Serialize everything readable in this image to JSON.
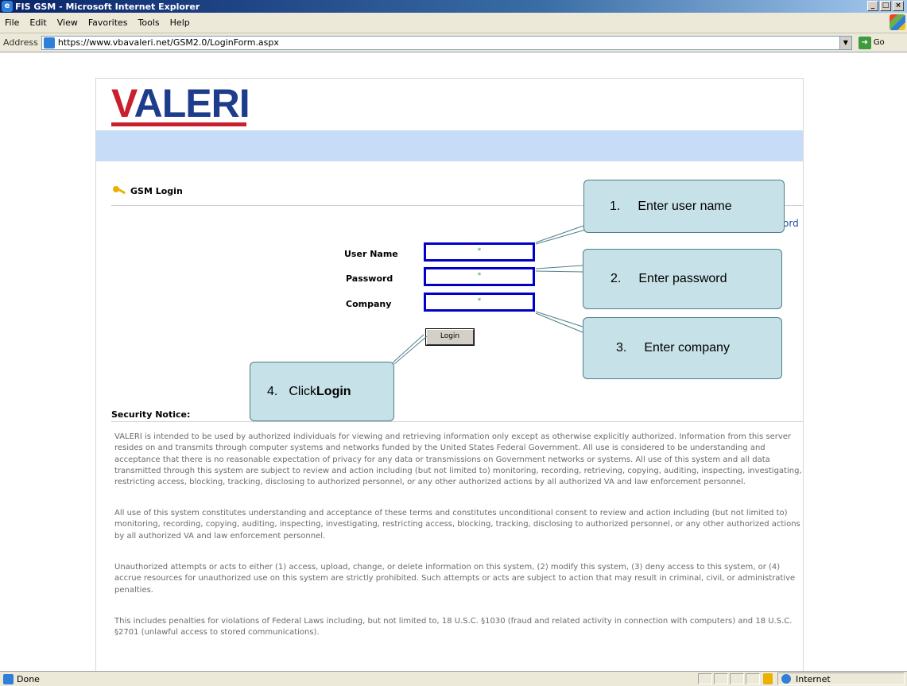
{
  "window": {
    "title": "FIS GSM - Microsoft Internet Explorer",
    "controls": [
      "_",
      "□",
      "×"
    ]
  },
  "menu": [
    "File",
    "Edit",
    "View",
    "Favorites",
    "Tools",
    "Help"
  ],
  "address": {
    "label": "Address",
    "url": "https://www.vbavaleri.net/GSM2.0/LoginForm.aspx",
    "go_label": "Go"
  },
  "page": {
    "logo_text": "VALERI",
    "section_title": "GSM Login",
    "cut_link_text": "ord",
    "form": {
      "username_label": "User Name",
      "password_label": "Password",
      "company_label": "Company",
      "field_marker": "*",
      "login_button": "Login"
    },
    "security_title": "Security Notice:",
    "notice_paragraphs": [
      "VALERI is intended to be used by authorized individuals for viewing and retrieving information only except as otherwise explicitly authorized. Information from this server resides on and transmits through computer systems and networks funded by the United States Federal Government. All use is considered to be understanding and acceptance that there is no reasonable expectation of privacy for any data or transmissions on Government networks or systems. All use of this system and all data transmitted through this system are subject to review and action including (but not limited to) monitoring, recording, retrieving, copying, auditing, inspecting, investigating, restricting access, blocking, tracking, disclosing to authorized personnel, or any other authorized actions by all authorized VA and law enforcement personnel.",
      "All use of this system constitutes understanding and acceptance of these terms and constitutes unconditional consent to review and action including (but not limited to) monitoring, recording, copying, auditing, inspecting, investigating, restricting access, blocking, tracking, disclosing to authorized personnel, or any other authorized actions by all authorized VA and law enforcement personnel.",
      "Unauthorized attempts or acts to either (1) access, upload, change, or delete information on this system, (2) modify this system, (3) deny access to this system, or (4) accrue resources for unauthorized use on this system are strictly prohibited. Such attempts or acts are subject to action that may result in criminal, civil, or administrative penalties.",
      "This includes penalties for violations of Federal Laws including, but not limited to, 18 U.S.C. §1030 (fraud and related activity in connection with computers) and 18 U.S.C. §2701 (unlawful access to stored communications)."
    ]
  },
  "callouts": {
    "c1": {
      "num": "1.",
      "text": "Enter user name"
    },
    "c2": {
      "num": "2.",
      "text": "Enter password"
    },
    "c3": {
      "num": "3.",
      "text": "Enter company"
    },
    "c4": {
      "num": "4.",
      "text": "Click ",
      "bold": "Login"
    }
  },
  "status": {
    "text": "Done",
    "zone": "Internet"
  }
}
